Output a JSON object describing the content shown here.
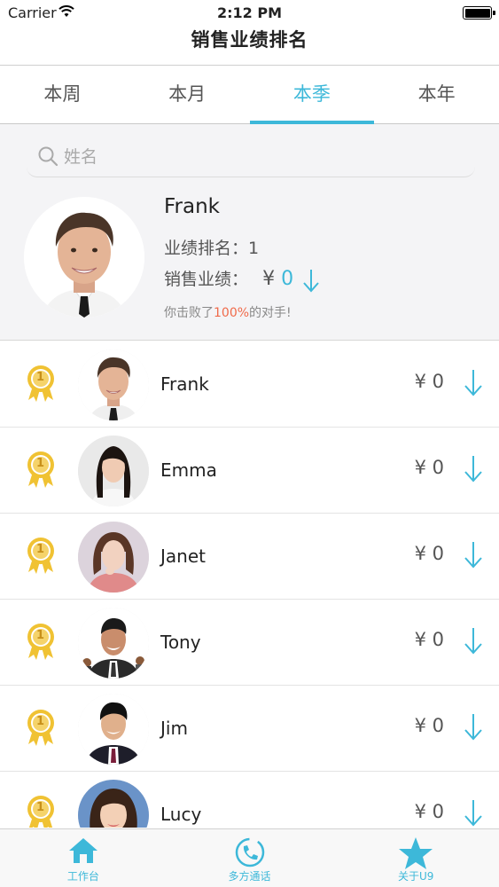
{
  "status_bar": {
    "carrier": "Carrier",
    "time": "2:12 PM"
  },
  "nav": {
    "title": "销售业绩排名"
  },
  "tabs": [
    {
      "label": "本周"
    },
    {
      "label": "本月"
    },
    {
      "label": "本季",
      "active": true
    },
    {
      "label": "本年"
    }
  ],
  "search": {
    "placeholder": "姓名",
    "value": ""
  },
  "profile": {
    "name": "Frank",
    "rank_label": "业绩排名：",
    "rank_value": "1",
    "sales_label": "销售业绩：",
    "currency": "¥",
    "sales_value": "0",
    "beat_prefix": "你击败了",
    "beat_percent": "100%",
    "beat_suffix": "的对手!"
  },
  "ranking": [
    {
      "rank": "1",
      "name": "Frank",
      "currency": "¥",
      "amount": "0"
    },
    {
      "rank": "1",
      "name": "Emma",
      "currency": "¥",
      "amount": "0"
    },
    {
      "rank": "1",
      "name": "Janet",
      "currency": "¥",
      "amount": "0"
    },
    {
      "rank": "1",
      "name": "Tony",
      "currency": "¥",
      "amount": "0"
    },
    {
      "rank": "1",
      "name": "Jim",
      "currency": "¥",
      "amount": "0"
    },
    {
      "rank": "1",
      "name": "Lucy",
      "currency": "¥",
      "amount": "0"
    }
  ],
  "tab_bar": [
    {
      "label": "工作台",
      "icon": "home-icon"
    },
    {
      "label": "多方通话",
      "icon": "phone-call-icon"
    },
    {
      "label": "关于U9",
      "icon": "star-icon"
    }
  ],
  "colors": {
    "accent": "#3db8d9",
    "highlight": "#f06a4a",
    "medal": "#f0c233"
  }
}
